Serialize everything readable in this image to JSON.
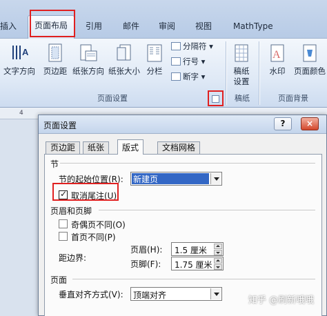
{
  "ribbon": {
    "tabs": [
      {
        "label": "插入"
      },
      {
        "label": "页面布局"
      },
      {
        "label": "引用"
      },
      {
        "label": "邮件"
      },
      {
        "label": "审阅"
      },
      {
        "label": "视图"
      },
      {
        "label": "MathType"
      }
    ],
    "active_tab": "页面布局",
    "page_setup_group": {
      "label": "页面设置",
      "buttons": [
        "文字方向",
        "页边距",
        "纸张方向",
        "纸张大小",
        "分栏"
      ],
      "small_buttons": [
        "分隔符",
        "行号",
        "断字"
      ]
    },
    "paper_group": {
      "label": "稿纸",
      "button": "稿纸\n设置"
    },
    "background_group": {
      "label": "页面背景",
      "buttons": [
        "水印",
        "页面颜色"
      ]
    }
  },
  "ruler": {
    "mark": "4"
  },
  "dialog": {
    "title": "页面设置",
    "help": "?",
    "close": "×",
    "tabs": [
      "页边距",
      "纸张",
      "版式",
      "文档网格"
    ],
    "active_tab": "版式",
    "section": {
      "heading": "节",
      "start_label": "节的起始位置(R):",
      "start_value": "新建页",
      "suppress_endnotes_label": "取消尾注(U)",
      "suppress_endnotes_checked": true
    },
    "header_footer": {
      "heading": "页眉和页脚",
      "odd_even_label": "奇偶页不同(O)",
      "odd_even_checked": false,
      "first_page_label": "首页不同(P)",
      "first_page_checked": false,
      "from_edge_label": "距边界:",
      "header_label": "页眉(H):",
      "header_value": "1.5 厘米",
      "footer_label": "页脚(F):",
      "footer_value": "1.75 厘米"
    },
    "page": {
      "heading": "页面",
      "vertical_align_label": "垂直对齐方式(V):",
      "vertical_align_value": "顶端对齐"
    }
  },
  "watermark": "知乎 @刷新哦哦"
}
